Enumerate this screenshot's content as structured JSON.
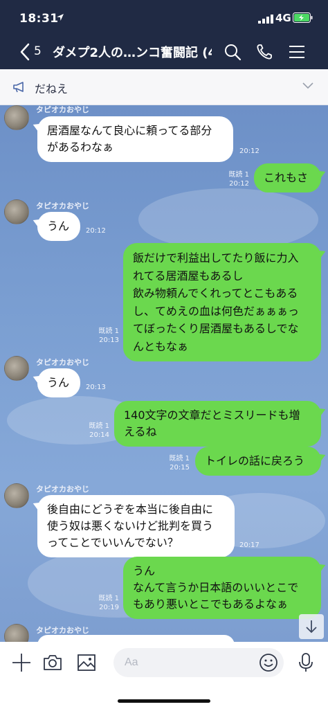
{
  "status_bar": {
    "time": "18:31",
    "network": "4G"
  },
  "header": {
    "back_count": "5",
    "title": "ダメプ2人の…ンコ奮闘記 (4)"
  },
  "announcement": {
    "text": "だねえ"
  },
  "colors": {
    "header_bg": "#202a44",
    "out_bubble": "#6bd84e",
    "in_bubble": "#ffffff"
  },
  "messages": [
    {
      "side": "in",
      "sender": "タピオカおやじ",
      "text": "居酒屋なんて良心に頼ってる部分\nがあるわなぁ",
      "read": "",
      "time": "20:12"
    },
    {
      "side": "out",
      "sender": "",
      "text": "これもさ",
      "read": "既読 1",
      "time": "20:12"
    },
    {
      "side": "in",
      "sender": "タピオカおやじ",
      "text": "うん",
      "read": "",
      "time": "20:12"
    },
    {
      "side": "out",
      "sender": "",
      "text": "飯だけで利益出してたり飯に力入\nれてる居酒屋もあるし\n飲み物頼んでくれってとこもある\nし、てめえの血は何色だぁぁぁっ\nてぼったくり居酒屋もあるしでな\nんともなぁ",
      "read": "既読 1",
      "time": "20:13"
    },
    {
      "side": "in",
      "sender": "タピオカおやじ",
      "text": "うん",
      "read": "",
      "time": "20:13"
    },
    {
      "side": "out",
      "sender": "",
      "text": "140文字の文章だとミスリードも増\nえるね",
      "read": "既読 1",
      "time": "20:14"
    },
    {
      "side": "out",
      "sender": "",
      "text": "トイレの話に戻ろう",
      "read": "既読 1",
      "time": "20:15"
    },
    {
      "side": "in",
      "sender": "タピオカおやじ",
      "text": "後自由にどうぞを本当に後自由に\n使う奴は悪くないけど批判を買う\nってことでいいんでない？",
      "read": "",
      "time": "20:17"
    },
    {
      "side": "out",
      "sender": "",
      "text": "うん\nなんて言うか日本語のいいとこで\nもあり悪いとこでもあるよなぁ",
      "read": "既読 1",
      "time": "20:19"
    },
    {
      "side": "in",
      "sender": "タピオカおやじ",
      "text": "",
      "read": "",
      "time": ""
    }
  ],
  "input": {
    "placeholder": "Aa"
  },
  "icons": {
    "back": "chevron-left-icon",
    "search": "search-icon",
    "call": "phone-icon",
    "menu": "hamburger-menu-icon",
    "announce": "megaphone-icon",
    "expand": "chevron-down-icon",
    "scroll": "arrow-down-icon",
    "add": "plus-icon",
    "camera": "camera-icon",
    "image": "image-icon",
    "emoji": "emoji-icon",
    "mic": "microphone-icon"
  }
}
